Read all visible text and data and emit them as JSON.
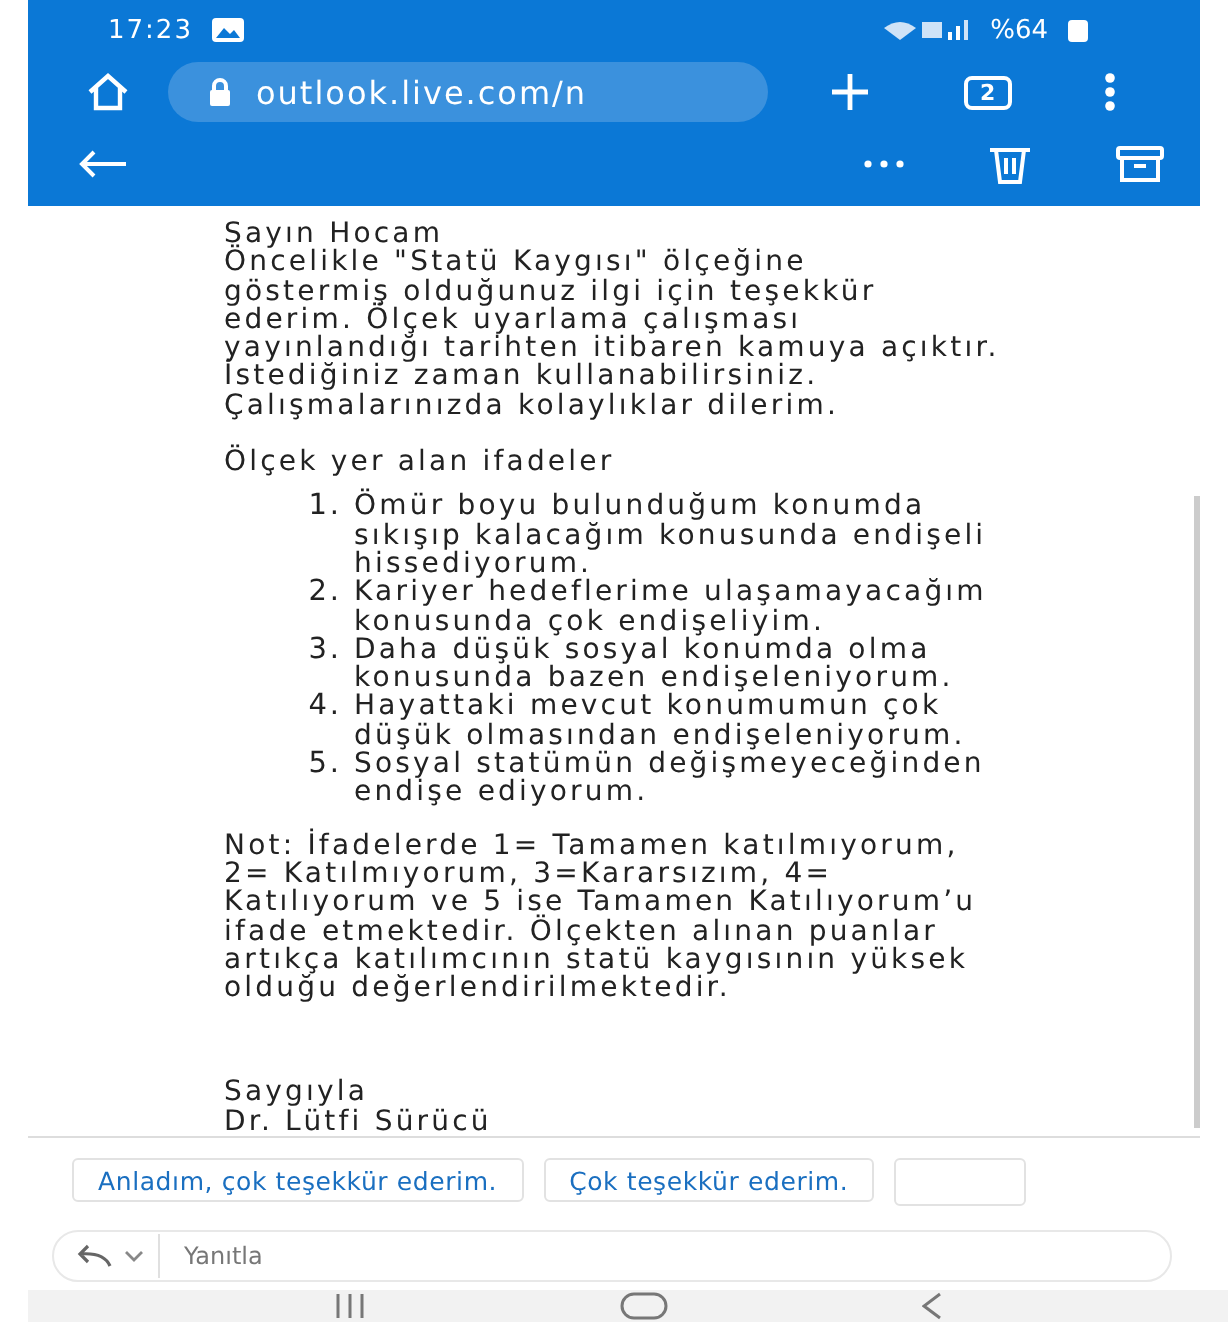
{
  "status_bar": {
    "time": "17:23",
    "battery": "%64"
  },
  "browser": {
    "url": "outlook.live.com/n",
    "tab_count": "2"
  },
  "message": {
    "greeting": "Sayın Hocam",
    "intro": "Öncelikle \"Statü Kaygısı\" ölçeğine\ngöstermiş olduğunuz ilgi için teşekkür\nederim. Ölçek uyarlama çalışması\nyayınlandığı tarihten itibaren kamuya açıktır.\nİstediğiniz zaman kullanabilirsiniz.\nÇalışmalarınızda kolaylıklar dilerim.",
    "list_heading": "Ölçek yer alan ifadeler",
    "items": [
      {
        "number": "1.",
        "text": "Ömür boyu bulunduğum konumda\nsıkışıp kalacağım konusunda endişeli\nhissediyorum."
      },
      {
        "number": "2.",
        "text": "Kariyer hedeflerime ulaşamayacağım\nkonusunda çok endişeliyim."
      },
      {
        "number": "3.",
        "text": "Daha düşük sosyal konumda olma\nkonusunda bazen endişeleniyorum."
      },
      {
        "number": "4.",
        "text": "Hayattaki mevcut konumumun çok\ndüşük olmasından endişeleniyorum."
      },
      {
        "number": "5.",
        "text": "Sosyal statümün değişmeyeceğinden\nendişe ediyorum."
      }
    ],
    "note": "Not: İfadelerde 1= Tamamen katılmıyorum,\n2= Katılmıyorum, 3=Kararsızım, 4=\nKatılıyorum ve 5 ise Tamamen Katılıyorum’u\nifade etmektedir. Ölçekten alınan puanlar\nartıkça katılımcının statü kaygısının yüksek\nolduğu değerlendirilmektedir.",
    "closing": "Saygıyla",
    "signature": "Dr. Lütfi Sürücü"
  },
  "quick_replies": [
    "Anladım, çok teşekkür ederim.",
    "Çok teşekkür ederim."
  ],
  "reply": {
    "placeholder": "Yanıtla"
  }
}
